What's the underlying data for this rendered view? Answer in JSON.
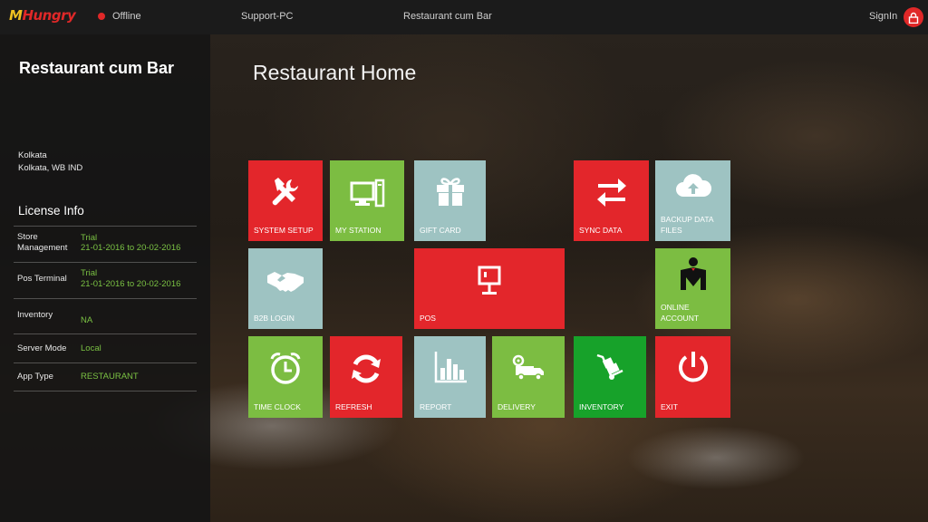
{
  "topbar": {
    "logo_prefix": "M",
    "logo_text": "Hungry",
    "status": "Offline",
    "host": "Support-PC",
    "outlet": "Restaurant cum Bar",
    "signin": "SignIn"
  },
  "sidebar": {
    "org_name": "Restaurant cum Bar",
    "address_line1": "Kolkata",
    "address_line2": "Kolkata, WB  IND",
    "license_title": "License Info",
    "license_rows": [
      {
        "label": "Store Management",
        "status": "Trial",
        "period": "21-01-2016 to 20-02-2016"
      },
      {
        "label": "Pos Terminal",
        "status": "Trial",
        "period": "21-01-2016 to 20-02-2016"
      },
      {
        "label": "Inventory",
        "status": "",
        "period": "NA"
      },
      {
        "label": "Server Mode",
        "status": "",
        "period": "Local"
      },
      {
        "label": "App Type",
        "status": "",
        "period": "RESTAURANT"
      }
    ]
  },
  "main": {
    "title": "Restaurant Home",
    "tiles": {
      "system_setup": "SYSTEM SETUP",
      "my_station": "MY STATION",
      "gift_card": "GIFT CARD",
      "sync_data": "SYNC DATA",
      "backup_data_files_1": "BACKUP DATA",
      "backup_data_files_2": "FILES",
      "b2b_login": "B2B LOGIN",
      "pos": "POS",
      "online_account_1": "ONLINE",
      "online_account_2": "ACCOUNT",
      "time_clock": "TIME CLOCK",
      "refresh": "REFRESH",
      "report": "REPORT",
      "delivery": "DELIVERY",
      "inventory": "INVENTORY",
      "exit": "EXIT"
    }
  },
  "colors": {
    "red": "#e3262b",
    "green": "#7cbd42",
    "teal": "#9ec3c2",
    "dark_green": "#17a22a",
    "accent_text_green": "#7ac143"
  }
}
